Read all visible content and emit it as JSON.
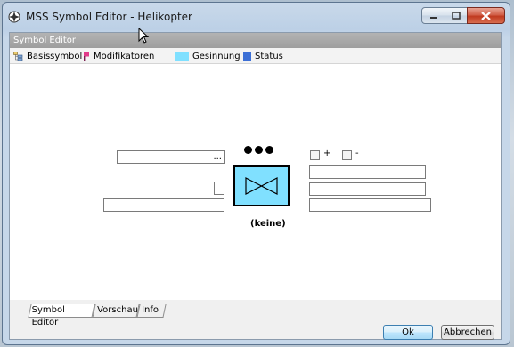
{
  "window": {
    "title": "MSS Symbol Editor - Helikopter",
    "controls": {
      "minimize": "minimize-icon",
      "maximize": "maximize-icon",
      "close": "close-icon"
    }
  },
  "panel": {
    "header": "Symbol Editor"
  },
  "toolbar": {
    "items": [
      {
        "label": "Basissymbol",
        "icon": "tree-icon"
      },
      {
        "label": "Modifikatoren",
        "icon": "pin-icon"
      },
      {
        "label": "Gesinnung",
        "icon": "cyan-swatch-icon"
      },
      {
        "label": "Status",
        "icon": "blue-swatch-icon"
      }
    ]
  },
  "editor": {
    "left_top_field": "...",
    "left_mid_field": "",
    "left_bottom_field": "",
    "right_fields": [
      "",
      "",
      ""
    ],
    "checkbox_plus_label": "+",
    "checkbox_minus_label": "-",
    "symbol_caption": "(keine)",
    "symbol_fill": "#80e0ff"
  },
  "tabs": [
    "Symbol Editor",
    "Vorschau",
    "Info"
  ],
  "buttons": {
    "ok": "Ok",
    "cancel": "Abbrechen"
  }
}
